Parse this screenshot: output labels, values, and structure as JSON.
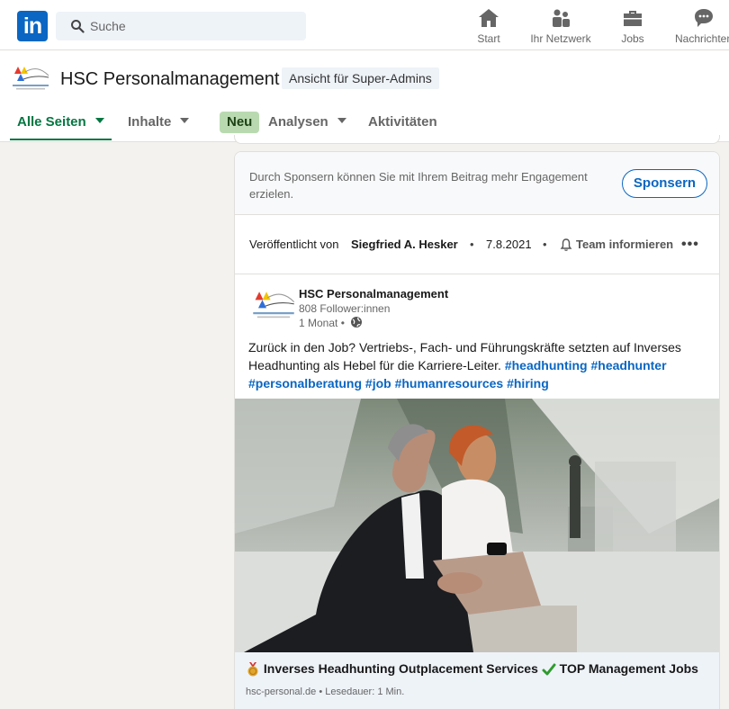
{
  "nav": {
    "logo_text": "in",
    "search_placeholder": "Suche",
    "items": [
      {
        "label": "Start",
        "icon": "home-icon"
      },
      {
        "label": "Ihr Netzwerk",
        "icon": "network-icon"
      },
      {
        "label": "Jobs",
        "icon": "briefcase-icon"
      },
      {
        "label": "Nachrichten",
        "icon": "messaging-icon"
      }
    ]
  },
  "page": {
    "company_name": "HSC Personalmanagement",
    "admin_badge": "Ansicht für Super-Admins",
    "tabs": [
      {
        "label": "Alle Seiten",
        "active": true
      },
      {
        "label": "Inhalte"
      },
      {
        "label": "Analysen"
      },
      {
        "label": "Aktivitäten"
      }
    ],
    "new_badge": "Neu"
  },
  "sponsor": {
    "text": "Durch Sponsern können Sie mit Ihrem Beitrag mehr Engagement erzielen.",
    "button": "Sponsern"
  },
  "publish": {
    "prefix": "Veröffentlicht von",
    "author": "Siegfried A. Hesker",
    "date": "7.8.2021",
    "notify": "Team informieren"
  },
  "post": {
    "author": "HSC Personalmanagement",
    "followers": "808 Follower:innen",
    "time": "1 Monat •",
    "text": "Zurück in den Job? Vertriebs-, Fach- und Führungskräfte setzten auf Inverses Headhunting als Hebel für die Karriere-Leiter.",
    "hashtags": [
      "#headhunting",
      "#headhunter",
      "#personalberatung",
      "#job",
      "#humanresources",
      "#hiring"
    ]
  },
  "preview": {
    "title_a": "Inverses Headhunting Outplacement Services",
    "title_b": "TOP Management Jobs",
    "meta": "hsc-personal.de • Lesedauer: 1 Min."
  },
  "colors": {
    "brand": "#0a66c2",
    "active_tab": "#057642",
    "new_badge_bg": "#b9dab0"
  }
}
